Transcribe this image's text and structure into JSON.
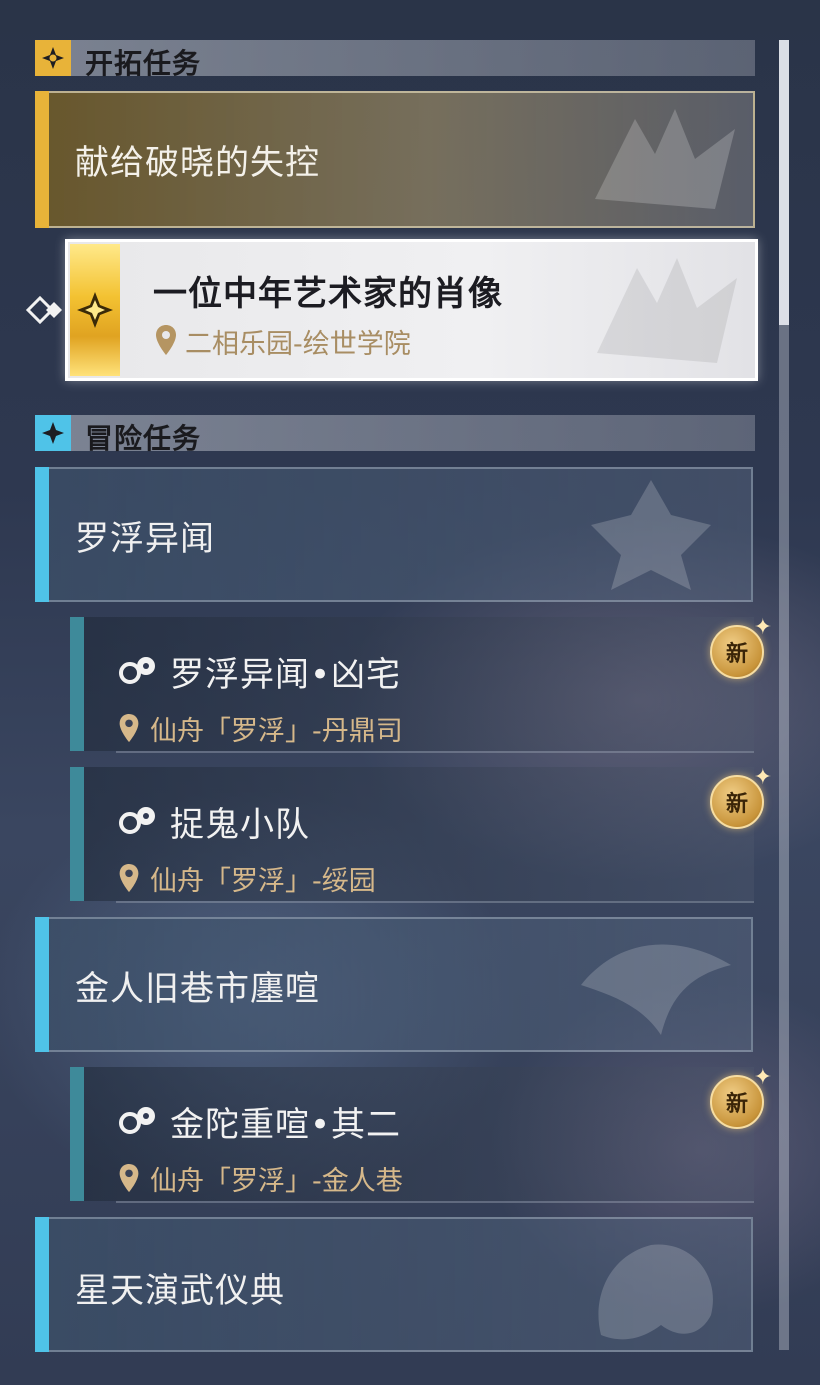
{
  "sections": {
    "trailblaze": {
      "title": "开拓任务"
    },
    "adventure": {
      "title": "冒险任务"
    }
  },
  "trailblaze_group": {
    "title": "献给破晓的失控"
  },
  "selected_quest": {
    "name": "一位中年艺术家的肖像",
    "location": "二相乐园-绘世学院"
  },
  "groups": [
    {
      "title": "罗浮异闻"
    },
    {
      "title": "金人旧巷市廛喧"
    },
    {
      "title": "星天演武仪典"
    }
  ],
  "items": [
    {
      "name": "罗浮异闻•凶宅",
      "location": "仙舟「罗浮」-丹鼎司",
      "badge": "新"
    },
    {
      "name": "捉鬼小队",
      "location": "仙舟「罗浮」-绥园",
      "badge": "新"
    },
    {
      "name": "金陀重喧•其二",
      "location": "仙舟「罗浮」-金人巷",
      "badge": "新"
    }
  ],
  "colors": {
    "trailblaze_accent": "#e8b339",
    "adventure_accent": "#4fc3e8",
    "location_text": "#d6b88a"
  }
}
